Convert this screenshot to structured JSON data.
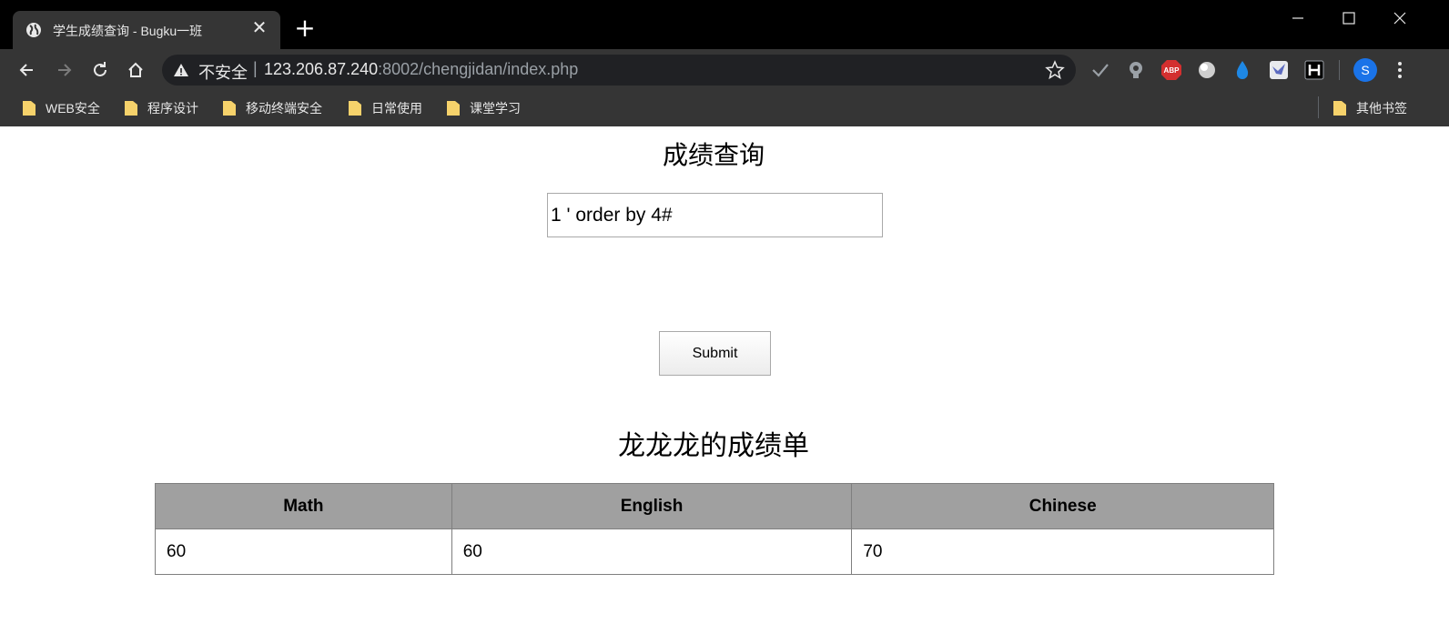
{
  "tab": {
    "title": "学生成绩查询 - Bugku一班",
    "close": "✕"
  },
  "new_tab": "+",
  "address_bar": {
    "security_label": "不安全",
    "separator": "|",
    "url_host": "123.206.87.240",
    "url_rest": ":8002/chengjidan/index.php"
  },
  "profile": {
    "initial": "S"
  },
  "bookmarks": [
    {
      "label": "WEB安全"
    },
    {
      "label": "程序设计"
    },
    {
      "label": "移动终端安全"
    },
    {
      "label": "日常使用"
    },
    {
      "label": "课堂学习"
    }
  ],
  "other_bookmarks": "其他书签",
  "page": {
    "heading": "成绩查询",
    "query_value": "1 ' order by 4#",
    "submit_label": "Submit",
    "report_heading": "龙龙龙的成绩单",
    "table": {
      "headers": [
        "Math",
        "English",
        "Chinese"
      ],
      "rows": [
        [
          "60",
          "60",
          "70"
        ]
      ]
    }
  },
  "colors": {
    "title_bar": "#000000",
    "toolbar": "#353535",
    "omnibox": "#202124",
    "table_header": "#a0a0a0",
    "folder": "#f6d26b"
  }
}
